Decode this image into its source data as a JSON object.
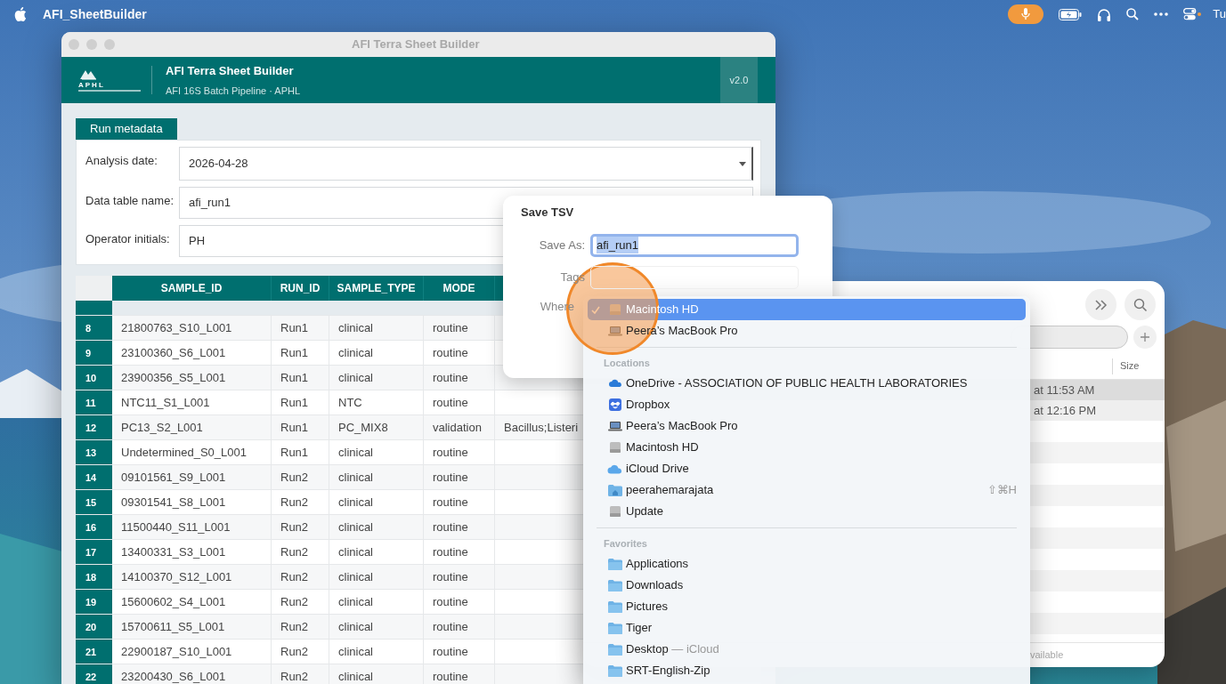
{
  "menu_bar": {
    "app_name": "AFI_SheetBuilder",
    "clock": "Tu"
  },
  "app_window": {
    "title": "AFI Terra Sheet Builder",
    "header": {
      "logo_text": "APHL",
      "title": "AFI Terra Sheet Builder",
      "subtitle": "AFI 16S Batch Pipeline · APHL",
      "version": "v2.0"
    },
    "tabs": [
      {
        "label": "Run metadata",
        "selected": true
      }
    ],
    "fields": [
      {
        "label": "Analysis date:",
        "value": "2026-04-28",
        "kind": "dropdown"
      },
      {
        "label": "Data table name:",
        "value": "afi_run1",
        "kind": "text"
      },
      {
        "label": "Operator initials:",
        "value": "PH",
        "kind": "text"
      }
    ],
    "table": {
      "columns": [
        "SAMPLE_ID",
        "RUN_ID",
        "SAMPLE_TYPE",
        "MODE"
      ],
      "rows": [
        {
          "number": "8",
          "cells": [
            "21800763_S10_L001",
            "Run1",
            "clinical",
            "routine"
          ]
        },
        {
          "number": "9",
          "cells": [
            "23100360_S6_L001",
            "Run1",
            "clinical",
            "routine"
          ]
        },
        {
          "number": "10",
          "cells": [
            "23900356_S5_L001",
            "Run1",
            "clinical",
            "routine"
          ]
        },
        {
          "number": "11",
          "cells": [
            "NTC11_S1_L001",
            "Run1",
            "NTC",
            "routine"
          ]
        },
        {
          "number": "12",
          "cells": [
            "PC13_S2_L001",
            "Run1",
            "PC_MIX8",
            "validation"
          ],
          "column_5": "Bacillus;Listeri"
        },
        {
          "number": "13",
          "cells": [
            "Undetermined_S0_L001",
            "Run1",
            "clinical",
            "routine"
          ]
        },
        {
          "number": "14",
          "cells": [
            "09101561_S9_L001",
            "Run2",
            "clinical",
            "routine"
          ]
        },
        {
          "number": "15",
          "cells": [
            "09301541_S8_L001",
            "Run2",
            "clinical",
            "routine"
          ]
        },
        {
          "number": "16",
          "cells": [
            "11500440_S11_L001",
            "Run2",
            "clinical",
            "routine"
          ]
        },
        {
          "number": "17",
          "cells": [
            "13400331_S3_L001",
            "Run2",
            "clinical",
            "routine"
          ]
        },
        {
          "number": "18",
          "cells": [
            "14100370_S12_L001",
            "Run2",
            "clinical",
            "routine"
          ]
        },
        {
          "number": "19",
          "cells": [
            "15600602_S4_L001",
            "Run2",
            "clinical",
            "routine"
          ]
        },
        {
          "number": "20",
          "cells": [
            "15700611_S5_L001",
            "Run2",
            "clinical",
            "routine"
          ]
        },
        {
          "number": "21",
          "cells": [
            "22900187_S10_L001",
            "Run2",
            "clinical",
            "routine"
          ]
        },
        {
          "number": "22",
          "cells": [
            "23200430_S6_L001",
            "Run2",
            "clinical",
            "routine"
          ]
        }
      ]
    }
  },
  "file_browser": {
    "size_column": "Size",
    "rows": [
      {
        "text": "at 11:53 AM",
        "selected": true
      },
      {
        "text": "at 12:16 PM",
        "selected": false
      }
    ],
    "footer": "vailable"
  },
  "save_dialog": {
    "title": "Save TSV",
    "save_as_label": "Save As:",
    "save_as_value": "afi_run1",
    "tags_label": "Tags",
    "where_label": "Where"
  },
  "location_menu": {
    "top_items": [
      {
        "label": "Macintosh HD",
        "kind": "disk",
        "selected": true
      },
      {
        "label": "Peera’s MacBook Pro",
        "kind": "laptop",
        "selected": false
      }
    ],
    "sections": [
      {
        "heading": "Locations",
        "items": [
          {
            "label": "OneDrive - ASSOCIATION OF PUBLIC HEALTH LABORATORIES",
            "kind": "onedrive",
            "selected": false
          },
          {
            "label": "Dropbox",
            "kind": "dropbox",
            "selected": false
          },
          {
            "label": "Peera’s MacBook Pro",
            "kind": "laptop",
            "selected": false
          },
          {
            "label": "Macintosh HD",
            "kind": "disk",
            "selected": false
          },
          {
            "label": "iCloud Drive",
            "kind": "cloud",
            "selected": false
          },
          {
            "label": "peerahemarajata",
            "kind": "home",
            "selected": false,
            "shortcut": "⇧⌘H"
          },
          {
            "label": "Update",
            "kind": "disk",
            "selected": false
          }
        ]
      },
      {
        "heading": "Favorites",
        "items": [
          {
            "label": "Applications",
            "kind": "folder",
            "selected": false
          },
          {
            "label": "Downloads",
            "kind": "folder",
            "selected": false
          },
          {
            "label": "Pictures",
            "kind": "folder",
            "selected": false
          },
          {
            "label": "Tiger",
            "kind": "folder",
            "selected": false
          },
          {
            "label": "Desktop",
            "detail": "— iCloud",
            "kind": "folder",
            "selected": false
          },
          {
            "label": "SRT-English-Zip",
            "kind": "folder",
            "selected": false
          }
        ]
      }
    ]
  }
}
